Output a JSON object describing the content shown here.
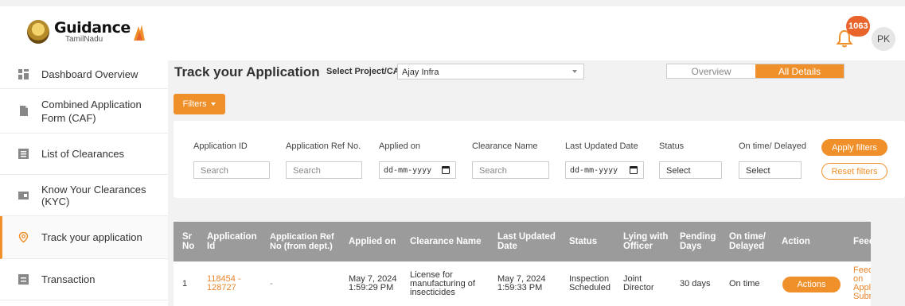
{
  "header": {
    "brand": "Guidance",
    "brand_sub": "TamilNadu",
    "notification_count": "1063",
    "avatar_initials": "PK"
  },
  "colors": {
    "accent": "#f0902b",
    "badge": "#e8642b",
    "table_header": "#9b9b9b"
  },
  "sidebar": {
    "items": [
      {
        "label": "Dashboard Overview",
        "icon": "dashboard-icon"
      },
      {
        "label": "Combined Application Form (CAF)",
        "icon": "document-icon"
      },
      {
        "label": "List of Clearances",
        "icon": "list-icon"
      },
      {
        "label": "Know Your Clearances (KYC)",
        "icon": "id-card-icon"
      },
      {
        "label": "Track your application",
        "icon": "location-pin-icon",
        "active": true
      },
      {
        "label": "Transaction",
        "icon": "transaction-icon"
      }
    ]
  },
  "main": {
    "title": "Track your Application",
    "project_label": "Select Project/CAF",
    "project_value": "Ajay Infra",
    "view_toggle": {
      "overview": "Overview",
      "all_details": "All Details",
      "selected": "All Details"
    },
    "filters_button": "Filters"
  },
  "filters": {
    "application_id": {
      "label": "Application ID",
      "placeholder": "Search"
    },
    "ref_no": {
      "label": "Application Ref No.",
      "placeholder": "Search"
    },
    "applied_on": {
      "label": "Applied on",
      "value": "dd-mm-yyyy"
    },
    "clearance_name": {
      "label": "Clearance Name",
      "placeholder": "Search"
    },
    "last_updated": {
      "label": "Last Updated Date",
      "value": "dd-mm-yyyy"
    },
    "status": {
      "label": "Status",
      "value": "Select"
    },
    "on_time": {
      "label": "On time/ Delayed",
      "value": "Select"
    },
    "apply_label": "Apply filters",
    "reset_label": "Reset filters"
  },
  "table": {
    "headers": {
      "sr_no": "Sr No",
      "application_id": "Application Id",
      "ref_no": "Application Ref No (from dept.)",
      "applied_on": "Applied on",
      "clearance_name": "Clearance Name",
      "last_updated": "Last Updated Date",
      "status": "Status",
      "lying_with": "Lying with Officer",
      "pending_days": "Pending Days",
      "on_time": "On time/ Delayed",
      "action": "Action",
      "feedback": "Feedback"
    },
    "rows": [
      {
        "sr_no": "1",
        "application_id": "118454 - 128727",
        "ref_no": "-",
        "applied_on": "May 7, 2024 1:59:29 PM",
        "clearance_name": "License for manufacturing of insecticides",
        "last_updated": "May 7, 2024 1:59:33 PM",
        "status": "Inspection Scheduled",
        "lying_with": "Joint Director",
        "pending_days": "30 days",
        "on_time": "On time",
        "action": "Actions",
        "feedback": "Feedback on Application Submission"
      }
    ]
  }
}
